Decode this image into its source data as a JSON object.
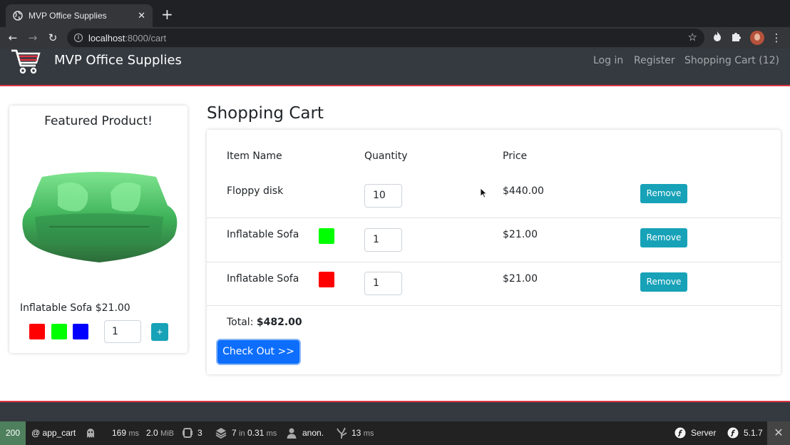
{
  "browser": {
    "tab_title": "MVP Office Supplies",
    "tab_close": "✕",
    "new_tab": "+",
    "url_host": "localhost",
    "url_path": ":8000/cart"
  },
  "navbar": {
    "brand": "MVP Office Supplies",
    "links": [
      "Log in",
      "Register",
      "Shopping Cart (12)"
    ]
  },
  "featured": {
    "title": "Featured Product!",
    "caption": "Inflatable Sofa $21.00",
    "swatch_colors": [
      "#ff0000",
      "#00ff00",
      "#0000ff"
    ],
    "quantity": "1",
    "add_label": "+"
  },
  "cart": {
    "heading": "Shopping Cart",
    "headers": [
      "Item Name",
      "Quantity",
      "Price"
    ],
    "items": [
      {
        "name": "Floppy disk",
        "color": "",
        "quantity": "10",
        "price": "$440.00",
        "action": "Remove"
      },
      {
        "name": "Inflatable Sofa",
        "color": "#00ff00",
        "quantity": "1",
        "price": "$21.00",
        "action": "Remove"
      },
      {
        "name": "Inflatable Sofa",
        "color": "#ff0000",
        "quantity": "1",
        "price": "$21.00",
        "action": "Remove"
      }
    ],
    "total_label": "Total:",
    "total_value": "$482.00",
    "checkout_label": "Check Out >>"
  },
  "profiler": {
    "status": "200",
    "route": "@ app_cart",
    "time_value": "169",
    "time_unit": "ms",
    "memory_value": "2.0",
    "memory_unit": "MiB",
    "forms": "3",
    "db_queries": "7",
    "db_in": "in",
    "db_time": "0.31",
    "db_unit": "ms",
    "user": "anon.",
    "twig_time": "13",
    "twig_unit": "ms",
    "server_label": "Server",
    "version": "5.1.7",
    "close": "✕"
  }
}
